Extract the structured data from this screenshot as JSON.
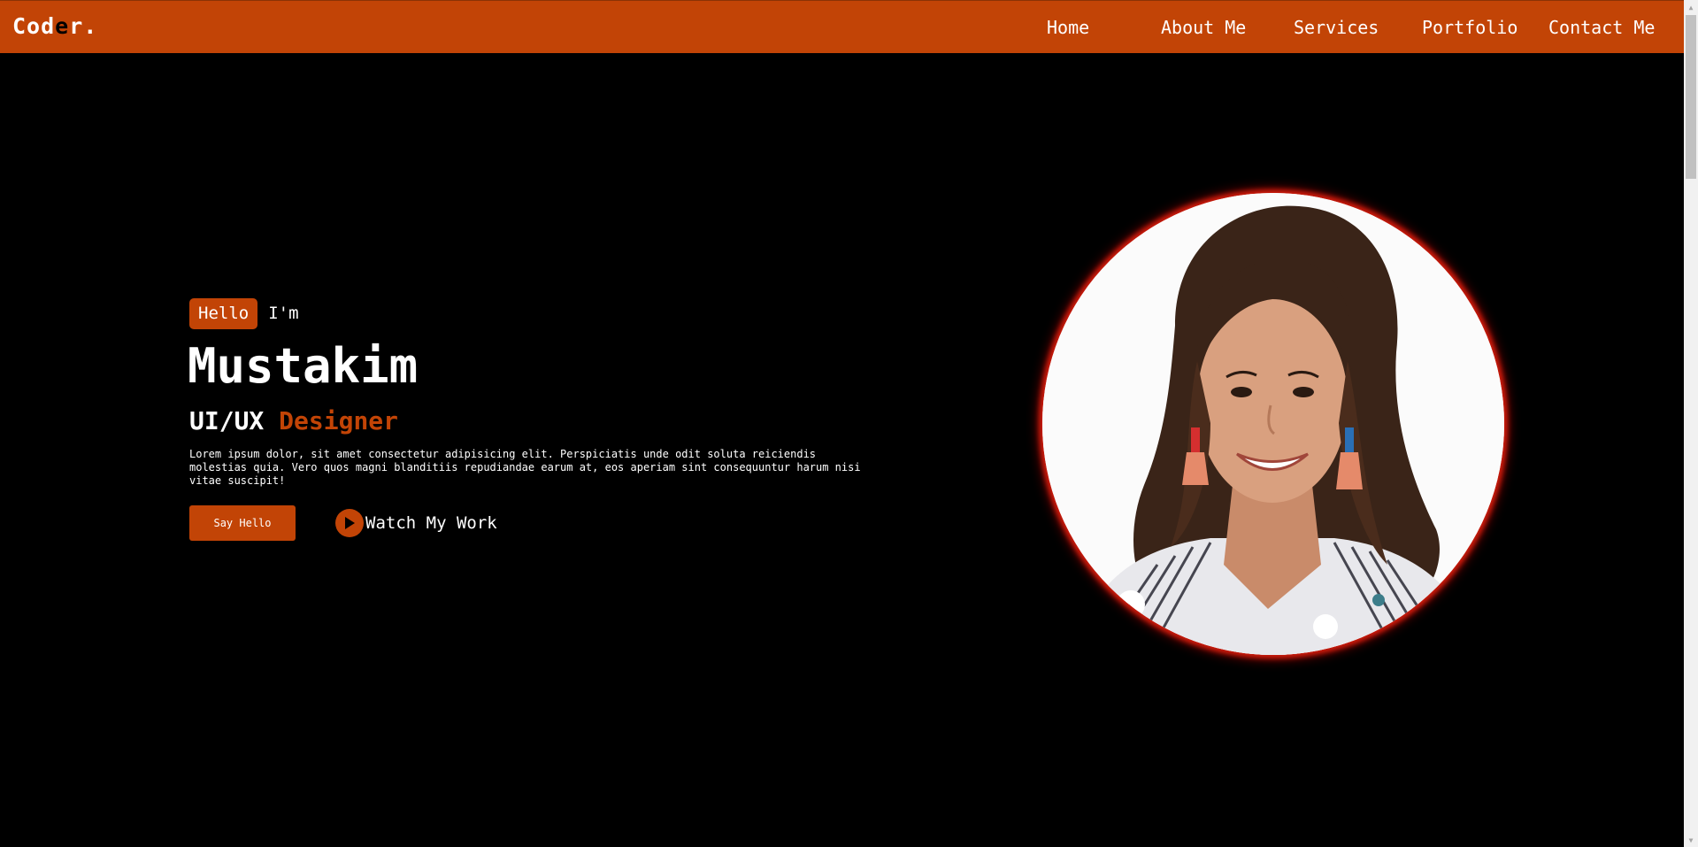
{
  "navbar": {
    "logo": {
      "part1": "Cod",
      "part2": "e",
      "part3": "r."
    },
    "links": [
      {
        "label": "Home"
      },
      {
        "label": "About Me"
      },
      {
        "label": "Services"
      },
      {
        "label": "Portfolio"
      },
      {
        "label": "Contact Me"
      }
    ]
  },
  "hero": {
    "greeting_badge": "Hello",
    "greeting_suffix": "I'm",
    "name": "Mustakim",
    "role_prefix": "UI/UX",
    "role_accent": "Designer",
    "description": "Lorem ipsum dolor, sit amet consectetur adipisicing elit. Perspiciatis unde odit soluta reiciendis molestias quia. Vero quos magni blanditiis repudiandae earum at, eos aperiam sint consequuntur harum nisi vitae suscipit!",
    "primary_button": "Say Hello",
    "secondary_button": "Watch My Work"
  },
  "colors": {
    "accent": "#c24406",
    "background": "#000000",
    "text": "#ffffff",
    "glow": "#d01c0c"
  },
  "icons": {
    "play": "play-icon",
    "scroll_up": "chevron-up-icon",
    "scroll_down": "chevron-down-icon"
  }
}
